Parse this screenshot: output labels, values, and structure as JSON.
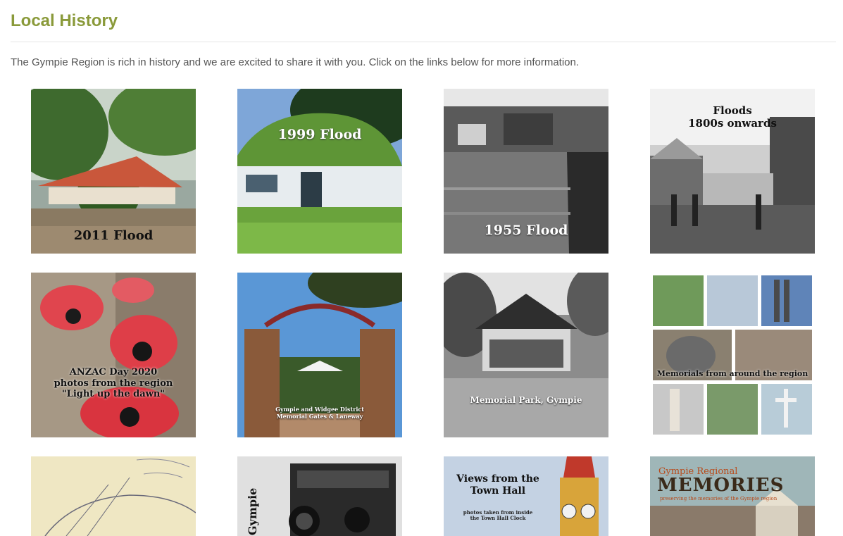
{
  "page": {
    "title": "Local History",
    "intro": "The Gympie Region is rich in history and we are excited to share it with you. Click on the links below for more information."
  },
  "tiles": [
    {
      "id": "2011-flood",
      "lines": [
        "2011 Flood"
      ],
      "bg": "#8a8a6a"
    },
    {
      "id": "1999-flood",
      "lines": [
        "1999 Flood"
      ],
      "bg": "#6d9a3e"
    },
    {
      "id": "1955-flood",
      "lines": [
        "1955 Flood"
      ],
      "bg": "#555555"
    },
    {
      "id": "floods-1800s",
      "lines": [
        "Floods",
        "1800s onwards"
      ],
      "bg": "#cfcfcf"
    },
    {
      "id": "anzac-2020",
      "lines": [
        "ANZAC Day 2020",
        "photos from the region",
        "\"Light up the dawn\""
      ],
      "bg": "#a89a86"
    },
    {
      "id": "memorial-gates",
      "lines": [
        "Gympie and Widgee District",
        "Memorial Gates & Laneway"
      ],
      "bg": "#4a86c8"
    },
    {
      "id": "memorial-park",
      "lines": [
        "Memorial Park, Gympie"
      ],
      "bg": "#777777"
    },
    {
      "id": "memorials-region",
      "lines": [
        "Memorials from around the region"
      ],
      "bg": "#e8e8e8"
    },
    {
      "id": "old-map",
      "lines": [],
      "bg": "#efe7c3"
    },
    {
      "id": "camera",
      "lines": [
        "Gympie"
      ],
      "bg": "#dcdcdc"
    },
    {
      "id": "town-hall",
      "lines": [
        "Views from the",
        "Town Hall",
        "photos taken from inside",
        "the Town Hall Clock"
      ],
      "bg": "#c4d2e3"
    },
    {
      "id": "regional-memories",
      "lines": [
        "Gympie Regional",
        "MEMORIES",
        "preserving the memories of the Gympie region"
      ],
      "bg": "#8aa4a8"
    }
  ]
}
